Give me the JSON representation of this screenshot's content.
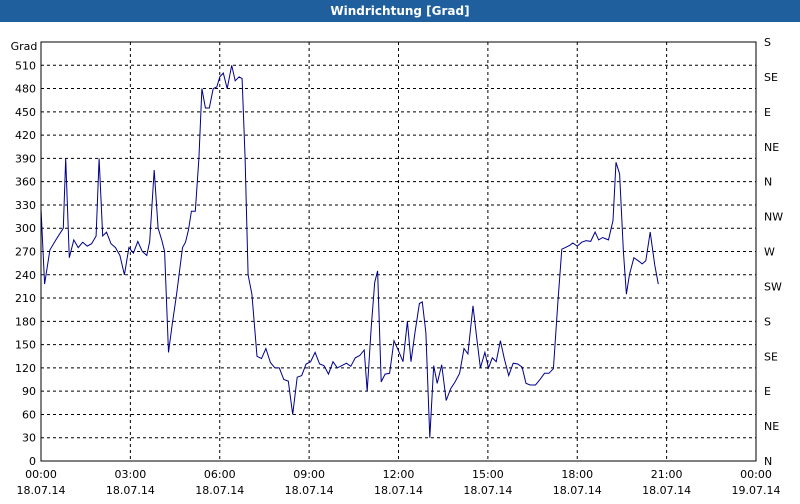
{
  "window": {
    "title": "Windrichtung [Grad]"
  },
  "chart_data": {
    "type": "line",
    "title": "Windrichtung [Grad]",
    "ylabel": "Grad",
    "ylim": [
      0,
      540
    ],
    "xlim": [
      "2014-07-18 00:00",
      "2014-07-19 00:00"
    ],
    "grid": true,
    "y_ticks": [
      0,
      30,
      60,
      90,
      120,
      150,
      180,
      210,
      240,
      270,
      300,
      330,
      360,
      390,
      420,
      450,
      480,
      510
    ],
    "y2_ticks": [
      {
        "value": 0,
        "label": "N"
      },
      {
        "value": 45,
        "label": "NE"
      },
      {
        "value": 90,
        "label": "E"
      },
      {
        "value": 135,
        "label": "SE"
      },
      {
        "value": 180,
        "label": "S"
      },
      {
        "value": 225,
        "label": "SW"
      },
      {
        "value": 270,
        "label": "W"
      },
      {
        "value": 315,
        "label": "NW"
      },
      {
        "value": 360,
        "label": "N"
      },
      {
        "value": 405,
        "label": "NE"
      },
      {
        "value": 450,
        "label": "E"
      },
      {
        "value": 495,
        "label": "SE"
      },
      {
        "value": 540,
        "label": "S"
      }
    ],
    "x_ticks": [
      {
        "hours": 0,
        "time": "00:00",
        "date": "18.07.14"
      },
      {
        "hours": 3,
        "time": "03:00",
        "date": "18.07.14"
      },
      {
        "hours": 6,
        "time": "06:00",
        "date": "18.07.14"
      },
      {
        "hours": 9,
        "time": "09:00",
        "date": "18.07.14"
      },
      {
        "hours": 12,
        "time": "12:00",
        "date": "18.07.14"
      },
      {
        "hours": 15,
        "time": "15:00",
        "date": "18.07.14"
      },
      {
        "hours": 18,
        "time": "18:00",
        "date": "18.07.14"
      },
      {
        "hours": 21,
        "time": "21:00",
        "date": "18.07.14"
      },
      {
        "hours": 24,
        "time": "00:00",
        "date": "19.07.14"
      }
    ],
    "series": [
      {
        "color": "#00008b",
        "points": [
          [
            0.0,
            325
          ],
          [
            0.12,
            228
          ],
          [
            0.3,
            272
          ],
          [
            0.5,
            285
          ],
          [
            0.75,
            300
          ],
          [
            0.83,
            390
          ],
          [
            0.95,
            262
          ],
          [
            1.1,
            285
          ],
          [
            1.25,
            275
          ],
          [
            1.4,
            282
          ],
          [
            1.55,
            277
          ],
          [
            1.7,
            280
          ],
          [
            1.85,
            290
          ],
          [
            1.95,
            390
          ],
          [
            2.07,
            290
          ],
          [
            2.2,
            295
          ],
          [
            2.35,
            280
          ],
          [
            2.5,
            275
          ],
          [
            2.65,
            265
          ],
          [
            2.8,
            240
          ],
          [
            2.95,
            275
          ],
          [
            3.1,
            268
          ],
          [
            3.25,
            283
          ],
          [
            3.4,
            270
          ],
          [
            3.55,
            265
          ],
          [
            3.65,
            283
          ],
          [
            3.8,
            375
          ],
          [
            3.93,
            300
          ],
          [
            4.05,
            285
          ],
          [
            4.15,
            270
          ],
          [
            4.28,
            140
          ],
          [
            4.4,
            175
          ],
          [
            4.55,
            215
          ],
          [
            4.75,
            275
          ],
          [
            4.85,
            282
          ],
          [
            4.95,
            298
          ],
          [
            5.05,
            322
          ],
          [
            5.18,
            322
          ],
          [
            5.3,
            390
          ],
          [
            5.4,
            480
          ],
          [
            5.52,
            455
          ],
          [
            5.65,
            455
          ],
          [
            5.78,
            480
          ],
          [
            5.9,
            482
          ],
          [
            6.0,
            495
          ],
          [
            6.12,
            500
          ],
          [
            6.25,
            480
          ],
          [
            6.4,
            510
          ],
          [
            6.52,
            490
          ],
          [
            6.65,
            495
          ],
          [
            6.75,
            493
          ],
          [
            6.85,
            390
          ],
          [
            6.95,
            240
          ],
          [
            7.08,
            215
          ],
          [
            7.25,
            135
          ],
          [
            7.4,
            132
          ],
          [
            7.55,
            145
          ],
          [
            7.7,
            127
          ],
          [
            7.85,
            120
          ],
          [
            8.0,
            120
          ],
          [
            8.15,
            105
          ],
          [
            8.3,
            103
          ],
          [
            8.45,
            60
          ],
          [
            8.6,
            108
          ],
          [
            8.75,
            110
          ],
          [
            8.9,
            125
          ],
          [
            9.05,
            128
          ],
          [
            9.2,
            140
          ],
          [
            9.35,
            125
          ],
          [
            9.5,
            123
          ],
          [
            9.65,
            112
          ],
          [
            9.8,
            128
          ],
          [
            9.95,
            120
          ],
          [
            10.1,
            123
          ],
          [
            10.25,
            126
          ],
          [
            10.4,
            122
          ],
          [
            10.55,
            133
          ],
          [
            10.7,
            136
          ],
          [
            10.85,
            143
          ],
          [
            10.95,
            90
          ],
          [
            11.08,
            170
          ],
          [
            11.2,
            230
          ],
          [
            11.3,
            245
          ],
          [
            11.42,
            102
          ],
          [
            11.55,
            112
          ],
          [
            11.7,
            113
          ],
          [
            11.85,
            155
          ],
          [
            12.0,
            142
          ],
          [
            12.15,
            128
          ],
          [
            12.3,
            180
          ],
          [
            12.42,
            128
          ],
          [
            12.55,
            165
          ],
          [
            12.7,
            203
          ],
          [
            12.8,
            205
          ],
          [
            12.92,
            165
          ],
          [
            13.05,
            30
          ],
          [
            13.18,
            123
          ],
          [
            13.3,
            100
          ],
          [
            13.45,
            124
          ],
          [
            13.6,
            78
          ],
          [
            13.75,
            93
          ],
          [
            13.9,
            102
          ],
          [
            14.05,
            113
          ],
          [
            14.2,
            145
          ],
          [
            14.33,
            138
          ],
          [
            14.5,
            200
          ],
          [
            14.62,
            160
          ],
          [
            14.75,
            120
          ],
          [
            14.9,
            140
          ],
          [
            15.02,
            120
          ],
          [
            15.15,
            133
          ],
          [
            15.28,
            128
          ],
          [
            15.42,
            155
          ],
          [
            15.55,
            132
          ],
          [
            15.7,
            110
          ],
          [
            15.85,
            126
          ],
          [
            16.0,
            125
          ],
          [
            16.15,
            121
          ],
          [
            16.28,
            100
          ],
          [
            16.42,
            98
          ],
          [
            16.6,
            98
          ],
          [
            16.75,
            105
          ],
          [
            16.9,
            113
          ],
          [
            17.05,
            113
          ],
          [
            17.2,
            119
          ],
          [
            17.35,
            205
          ],
          [
            17.48,
            273
          ],
          [
            17.6,
            275
          ],
          [
            17.75,
            278
          ],
          [
            17.85,
            281
          ],
          [
            18.0,
            277
          ],
          [
            18.15,
            282
          ],
          [
            18.3,
            284
          ],
          [
            18.45,
            283
          ],
          [
            18.6,
            295
          ],
          [
            18.72,
            285
          ],
          [
            18.85,
            288
          ],
          [
            19.05,
            285
          ],
          [
            19.2,
            310
          ],
          [
            19.3,
            385
          ],
          [
            19.42,
            370
          ],
          [
            19.55,
            270
          ],
          [
            19.65,
            215
          ],
          [
            19.75,
            240
          ],
          [
            19.9,
            262
          ],
          [
            20.05,
            258
          ],
          [
            20.18,
            254
          ],
          [
            20.3,
            258
          ],
          [
            20.45,
            295
          ],
          [
            20.6,
            253
          ],
          [
            20.72,
            228
          ]
        ]
      }
    ]
  }
}
